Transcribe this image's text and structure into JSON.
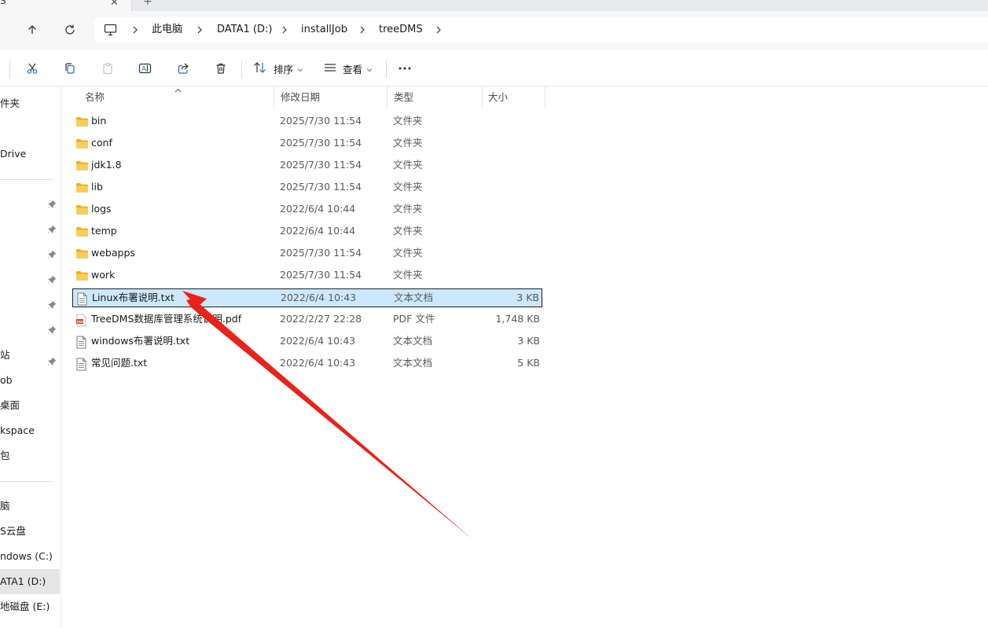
{
  "tab": {
    "title": "S"
  },
  "breadcrumb": [
    "此电脑",
    "DATA1 (D:)",
    "installJob",
    "treeDMS"
  ],
  "toolbar": {
    "sort_label": "排序",
    "view_label": "查看"
  },
  "sidebar": {
    "items": [
      {
        "label": "件夹"
      },
      {
        "label": "Drive"
      },
      {
        "label": "站"
      },
      {
        "label": "ob"
      },
      {
        "label": "桌面"
      },
      {
        "label": "kspace"
      },
      {
        "label": "包"
      },
      {
        "label": "脑"
      },
      {
        "label": "S云盘"
      },
      {
        "label": "ndows (C:)"
      },
      {
        "label": "ATA1 (D:)"
      },
      {
        "label": "地磁盘 (E:)"
      }
    ]
  },
  "columns": {
    "name": "名称",
    "date": "修改日期",
    "type": "类型",
    "size": "大小"
  },
  "files": [
    {
      "name": "bin",
      "date": "2025/7/30 11:54",
      "type": "文件夹",
      "size": "",
      "icon": "folder-icon"
    },
    {
      "name": "conf",
      "date": "2025/7/30 11:54",
      "type": "文件夹",
      "size": "",
      "icon": "folder-icon"
    },
    {
      "name": "jdk1.8",
      "date": "2025/7/30 11:54",
      "type": "文件夹",
      "size": "",
      "icon": "folder-icon"
    },
    {
      "name": "lib",
      "date": "2025/7/30 11:54",
      "type": "文件夹",
      "size": "",
      "icon": "folder-icon"
    },
    {
      "name": "logs",
      "date": "2022/6/4 10:44",
      "type": "文件夹",
      "size": "",
      "icon": "folder-icon"
    },
    {
      "name": "temp",
      "date": "2022/6/4 10:44",
      "type": "文件夹",
      "size": "",
      "icon": "folder-icon"
    },
    {
      "name": "webapps",
      "date": "2025/7/30 11:54",
      "type": "文件夹",
      "size": "",
      "icon": "folder-icon"
    },
    {
      "name": "work",
      "date": "2025/7/30 11:54",
      "type": "文件夹",
      "size": "",
      "icon": "folder-icon"
    },
    {
      "name": "Linux布署说明.txt",
      "date": "2022/6/4 10:43",
      "type": "文本文档",
      "size": "3 KB",
      "icon": "text-file-icon"
    },
    {
      "name": "TreeDMS数据库管理系统说明.pdf",
      "date": "2022/2/27 22:28",
      "type": "PDF 文件",
      "size": "1,748 KB",
      "icon": "pdf-file-icon"
    },
    {
      "name": "windows布署说明.txt",
      "date": "2022/6/4 10:43",
      "type": "文本文档",
      "size": "3 KB",
      "icon": "text-file-icon"
    },
    {
      "name": "常见问题.txt",
      "date": "2022/6/4 10:43",
      "type": "文本文档",
      "size": "5 KB",
      "icon": "text-file-icon"
    }
  ],
  "selected_file": "Linux布署说明.txt",
  "colors": {
    "selection": "#cce8ff",
    "folder": "#f4c542",
    "annotation_arrow": "#e8231b"
  }
}
